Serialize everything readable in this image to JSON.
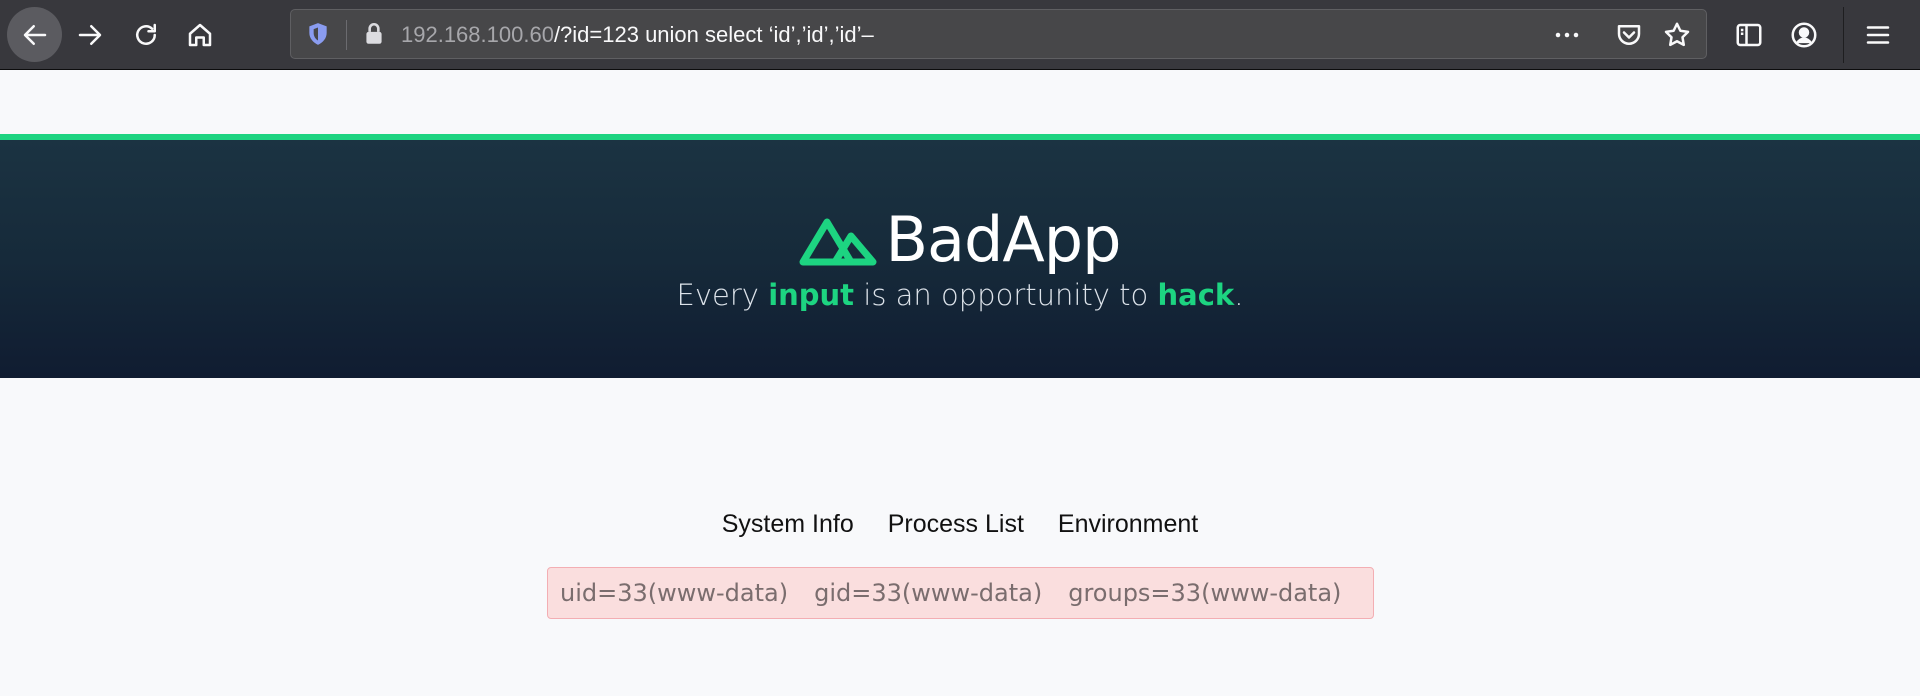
{
  "browser": {
    "url_host": "192.168.100.60",
    "url_rest": "/?id=123 union select ‘id’,’id’,’id’–"
  },
  "colors": {
    "accent": "#1dd481",
    "toolbar": "#38383d",
    "hero_dark": "#101c31",
    "error_bg": "#fadede",
    "error_border": "#f3aeb3"
  },
  "brand": {
    "name": "BadApp",
    "logo_icon": "mountain-logo-icon"
  },
  "tagline": {
    "part1": "Every ",
    "highlight1": "input",
    "part2": " is an opportunity to ",
    "highlight2": "hack",
    "part3": "."
  },
  "tabs": [
    {
      "label": "System Info"
    },
    {
      "label": "Process List"
    },
    {
      "label": "Environment"
    }
  ],
  "output": {
    "uid": "uid=33(www-data)",
    "gid": "gid=33(www-data)",
    "groups": "groups=33(www-data)"
  }
}
